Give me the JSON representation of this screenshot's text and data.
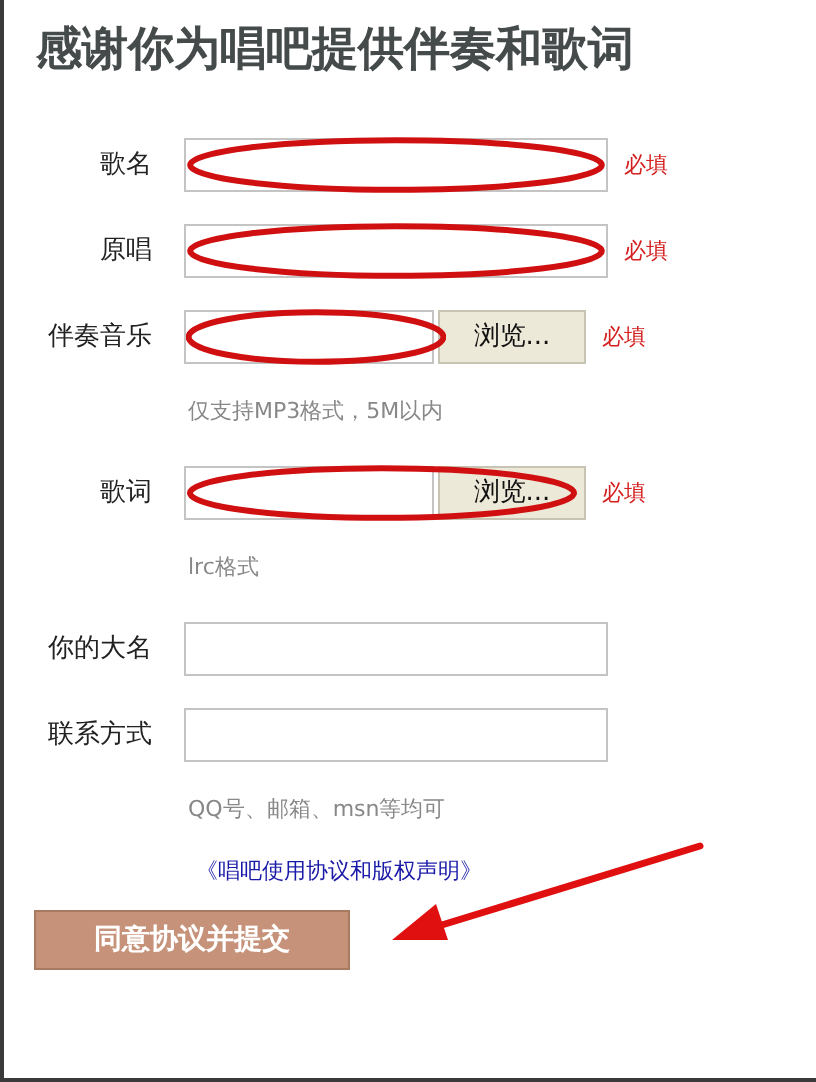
{
  "title": "感谢你为唱吧提供伴奏和歌词",
  "rows": [
    {
      "kind": "text",
      "label": "歌名",
      "required": "必填",
      "circled": true
    },
    {
      "kind": "text",
      "label": "原唱",
      "required": "必填",
      "circled": true
    },
    {
      "kind": "file",
      "label": "伴奏音乐",
      "button": "浏览...",
      "required": "必填",
      "hint": "仅支持MP3格式，5M以内",
      "circled": true
    },
    {
      "kind": "file",
      "label": "歌词",
      "button": "浏览...",
      "required": "必填",
      "hint": "lrc格式",
      "circled": true
    },
    {
      "kind": "text",
      "label": "你的大名",
      "circled": false
    },
    {
      "kind": "text",
      "label": "联系方式",
      "hint": "QQ号、邮箱、msn等均可",
      "circled": false
    }
  ],
  "agreement_link": "《唱吧使用协议和版权声明》",
  "submit": "同意协议并提交"
}
